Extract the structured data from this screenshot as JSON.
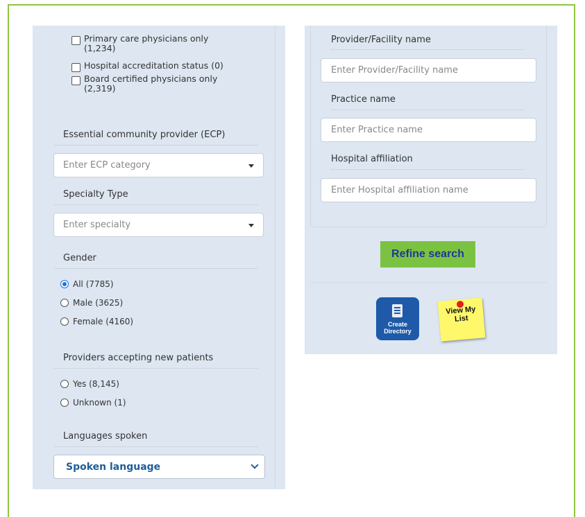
{
  "filters": {
    "checkboxes": [
      {
        "label": "Primary care physicians only (1,234)",
        "checked": false
      },
      {
        "label": "Hospital accreditation status (0)",
        "checked": false
      },
      {
        "label": "Board certified physicians only (2,319)",
        "checked": false
      }
    ],
    "ecp": {
      "label": "Essential community provider (ECP)",
      "placeholder": "Enter ECP category"
    },
    "specialty": {
      "label": "Specialty Type",
      "placeholder": "Enter specialty"
    },
    "gender": {
      "label": "Gender",
      "options": [
        {
          "label": "All (7785)",
          "selected": true
        },
        {
          "label": "Male (3625)",
          "selected": false
        },
        {
          "label": "Female (4160)",
          "selected": false
        }
      ]
    },
    "new_patients": {
      "label": "Providers accepting new patients",
      "options": [
        {
          "label": "Yes (8,145)",
          "selected": false
        },
        {
          "label": "Unknown (1)",
          "selected": false
        }
      ]
    },
    "languages": {
      "label": "Languages spoken",
      "selected": "Spoken language"
    }
  },
  "search": {
    "provider": {
      "label": "Provider/Facility name",
      "placeholder": "Enter Provider/Facility name"
    },
    "practice": {
      "label": "Practice name",
      "placeholder": "Enter Practice name"
    },
    "hospital": {
      "label": "Hospital affiliation",
      "placeholder": "Enter Hospital affiliation name"
    },
    "refine_label": "Refine search"
  },
  "actions": {
    "create_directory_line1": "Create",
    "create_directory_line2": "Directory",
    "view_list_line1": "View My",
    "view_list_line2": "List"
  },
  "colors": {
    "frame_border": "#8dc63f",
    "panel_bg": "#dde6f1",
    "refine_bg": "#7cc242",
    "refine_text": "#1a3a99",
    "create_bg": "#1e5aa8",
    "sticky_bg": "#fff86b",
    "radio_selected": "#1a73e8"
  }
}
